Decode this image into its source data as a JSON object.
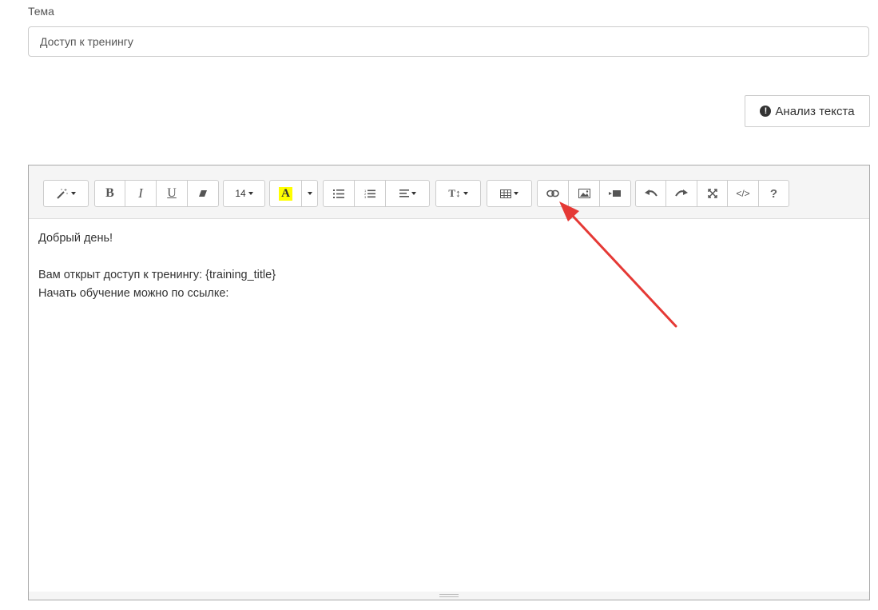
{
  "subject": {
    "label": "Тема",
    "value": "Доступ к тренингу"
  },
  "analyze_button": {
    "icon": "exclamation-circle-icon",
    "label": "Анализ текста"
  },
  "toolbar": {
    "font_size": "14",
    "highlight_letter": "A",
    "groups": [
      [
        "magic-wand-icon"
      ],
      [
        "bold-icon",
        "italic-icon",
        "underline-icon",
        "eraser-icon"
      ],
      [
        "font-size-dropdown"
      ],
      [
        "highlight-color-icon",
        "color-dropdown"
      ],
      [
        "unordered-list-icon",
        "ordered-list-icon",
        "align-dropdown"
      ],
      [
        "text-height-dropdown"
      ],
      [
        "table-dropdown"
      ],
      [
        "link-icon",
        "image-icon",
        "video-icon"
      ],
      [
        "undo-icon",
        "redo-icon",
        "fullscreen-icon",
        "code-view-icon",
        "help-icon"
      ]
    ]
  },
  "editor": {
    "lines": [
      "Добрый день!",
      "",
      "Вам открыт доступ к тренингу: {training_title}",
      "Начать обучение можно по ссылке:"
    ]
  },
  "colors": {
    "annotation_arrow": "#e53935",
    "highlight": "#ffff00",
    "toolbar_bg": "#f5f5f5"
  }
}
